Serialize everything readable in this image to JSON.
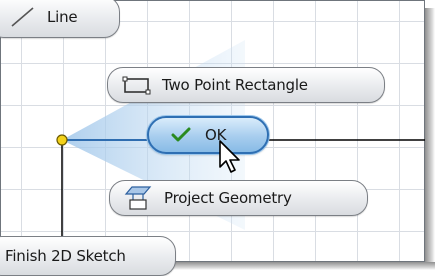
{
  "marking_menu": {
    "line_label": "Line",
    "rectangle_label": "Two Point Rectangle",
    "ok_label": "OK",
    "project_geometry_label": "Project Geometry",
    "finish_sketch_label": "Finish 2D Sketch"
  },
  "icons": {
    "line": "line-icon",
    "rectangle": "rectangle-icon",
    "ok": "checkmark-icon",
    "project": "project-geometry-icon",
    "cursor": "mouse-cursor-icon",
    "sketch_point": "sketch-point-icon"
  },
  "colors": {
    "ok_border": "#2e6fb3",
    "ok_fill": "#a7cdee",
    "checkmark": "#2a8a1f",
    "sketch_point": "#f3d21a",
    "grid": "#d9dde3"
  }
}
